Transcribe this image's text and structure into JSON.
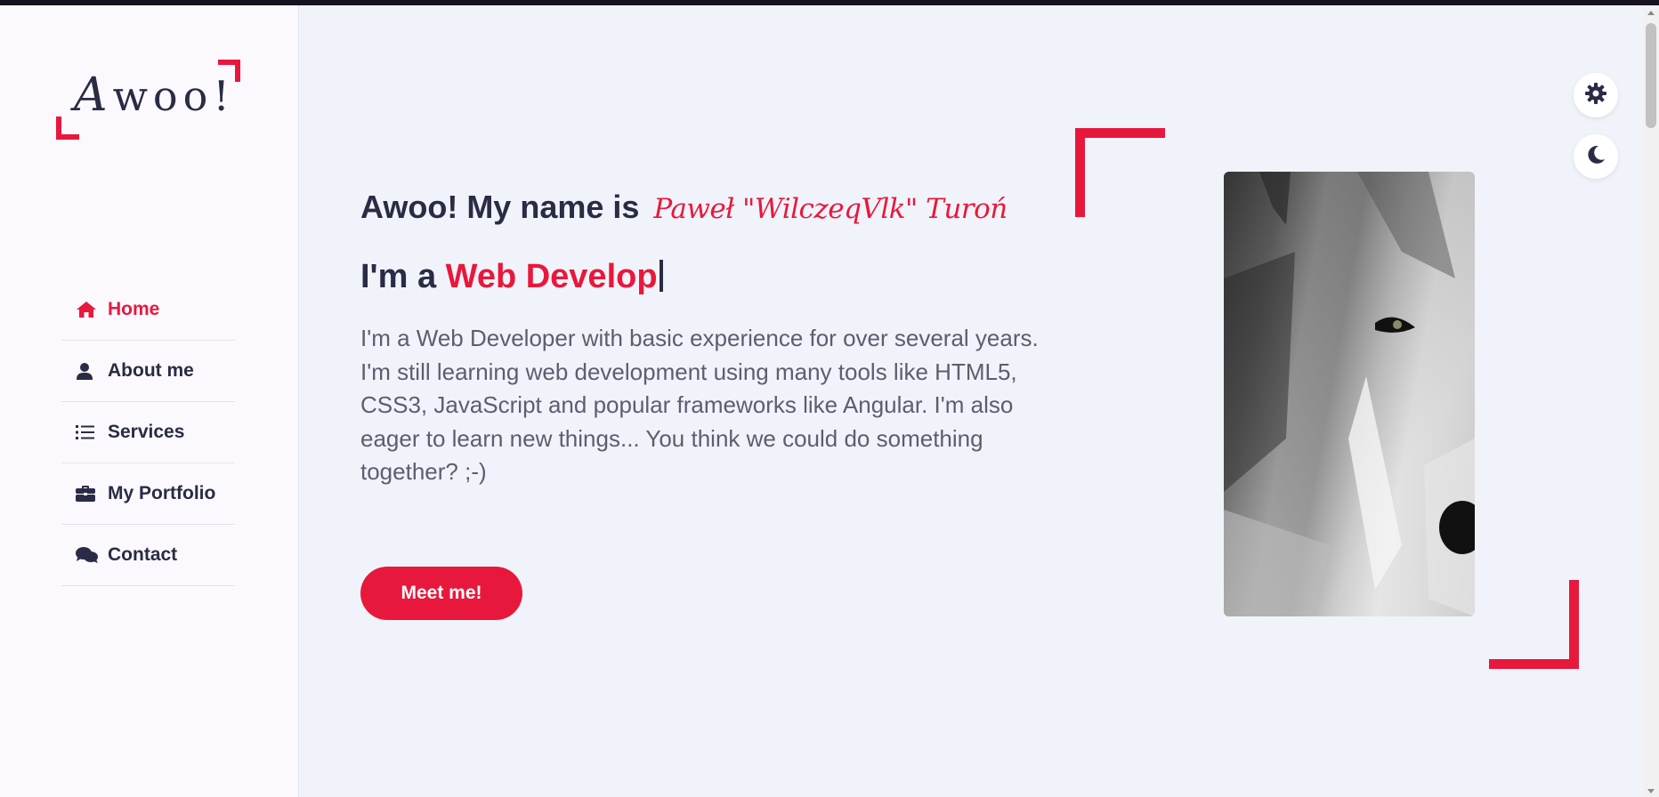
{
  "logo": {
    "first_letter": "A",
    "rest": "woo!"
  },
  "nav": {
    "items": [
      {
        "label": "Home",
        "icon": "home-icon",
        "active": true
      },
      {
        "label": "About me",
        "icon": "user-icon",
        "active": false
      },
      {
        "label": "Services",
        "icon": "list-icon",
        "active": false
      },
      {
        "label": "My Portfolio",
        "icon": "briefcase-icon",
        "active": false
      },
      {
        "label": "Contact",
        "icon": "comments-icon",
        "active": false
      }
    ]
  },
  "hero": {
    "greeting": "Awoo! My name is",
    "name": "Paweł \"WilczeqVlk\" Turoń",
    "role_prefix": "I'm a",
    "role_typed": "Web Develop",
    "intro": "I'm a Web Developer with basic experience for over several years. I'm still learning web development using many tools like HTML5, CSS3, JavaScript and popular frameworks like Angular. I'm also eager to learn new things... You think we could do something together? ;-)",
    "cta_label": "Meet me!"
  },
  "floating_buttons": {
    "settings_icon": "gear-icon",
    "theme_icon": "moon-icon"
  },
  "colors": {
    "accent": "#e8183c",
    "text_dark": "#2a2b44",
    "background": "#f1f3fa",
    "sidebar": "#fbf9fd"
  }
}
